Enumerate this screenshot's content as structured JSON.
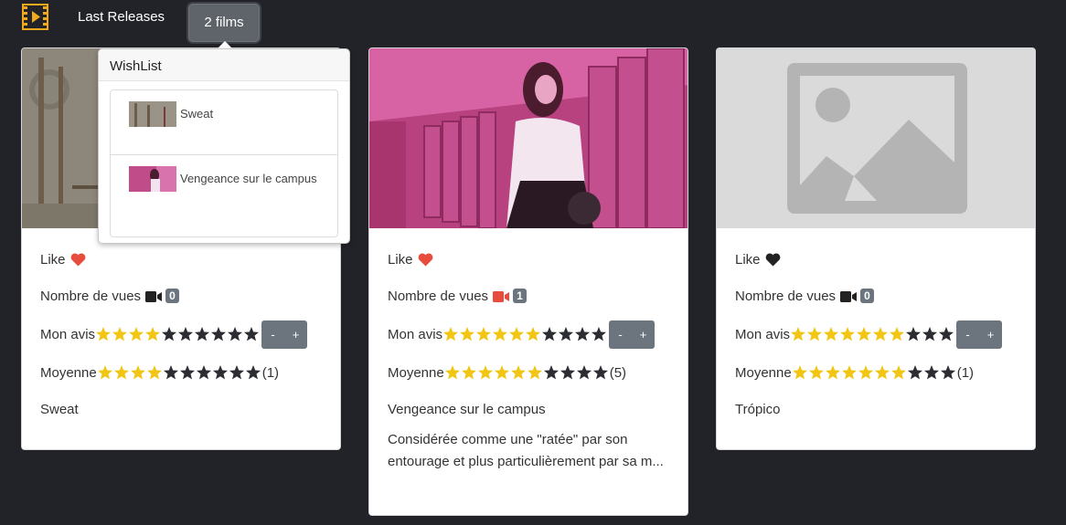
{
  "navbar": {
    "logo_icon": "film-icon",
    "link_label": "Last Releases",
    "wishlist_button_label": "2 films"
  },
  "wishlist": {
    "title": "WishList",
    "items": [
      {
        "title": "Sweat"
      },
      {
        "title": "Vengeance sur le campus"
      }
    ]
  },
  "labels": {
    "like": "Like",
    "views": "Nombre de vues",
    "my_rating": "Mon avis",
    "average": "Moyenne",
    "minus": "-",
    "plus": "+"
  },
  "colors": {
    "star_on": "#f2c512",
    "star_off": "#2b2d33",
    "heart_liked": "#e74c3c",
    "heart_unliked": "#2b2d33",
    "camera_active": "#e74c3c",
    "camera_idle": "#222222"
  },
  "films": [
    {
      "title": "Sweat",
      "liked": true,
      "views": "0",
      "my_rating": 4,
      "average_rating": 4,
      "average_count": "(1)",
      "description": ""
    },
    {
      "title": "Vengeance sur le campus",
      "liked": true,
      "views": "1",
      "my_rating": 6,
      "average_rating": 6,
      "average_count": "(5)",
      "description": "Considérée comme une \"ratée\" par son entourage et plus particulièrement par sa m..."
    },
    {
      "title": "Trópico",
      "liked": false,
      "views": "0",
      "my_rating": 7,
      "average_rating": 7,
      "average_count": "(1)",
      "description": ""
    }
  ]
}
